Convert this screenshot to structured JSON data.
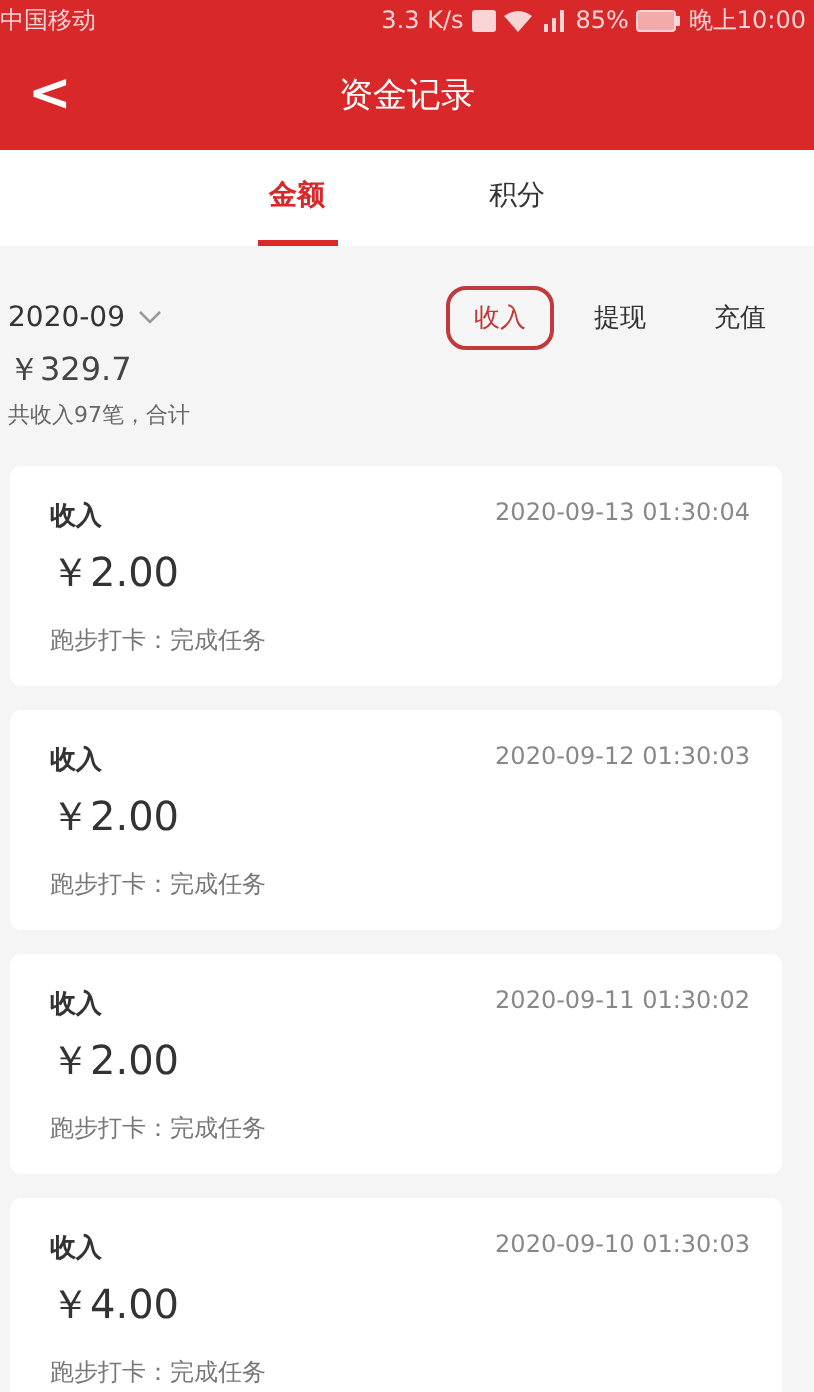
{
  "status_bar": {
    "carrier": "中国移动",
    "speed": "3.3 K/s",
    "battery": "85%",
    "time": "晚上10:00"
  },
  "header": {
    "back": "<",
    "title": "资金记录"
  },
  "tabs": [
    {
      "label": "金额",
      "selected": true
    },
    {
      "label": "积分",
      "selected": false
    }
  ],
  "filter": {
    "month": "2020-09",
    "types": [
      {
        "label": "收入",
        "selected": true
      },
      {
        "label": "提现",
        "selected": false
      },
      {
        "label": "充值",
        "selected": false
      }
    ]
  },
  "summary": {
    "total": "￥329.7",
    "note": "共收入97笔，合计"
  },
  "records": [
    {
      "type": "收入",
      "time": "2020-09-13 01:30:04",
      "amount": "￥2.00",
      "desc": "跑步打卡：完成任务"
    },
    {
      "type": "收入",
      "time": "2020-09-12 01:30:03",
      "amount": "￥2.00",
      "desc": "跑步打卡：完成任务"
    },
    {
      "type": "收入",
      "time": "2020-09-11 01:30:02",
      "amount": "￥2.00",
      "desc": "跑步打卡：完成任务"
    },
    {
      "type": "收入",
      "time": "2020-09-10 01:30:03",
      "amount": "￥4.00",
      "desc": "跑步打卡：完成任务"
    }
  ]
}
